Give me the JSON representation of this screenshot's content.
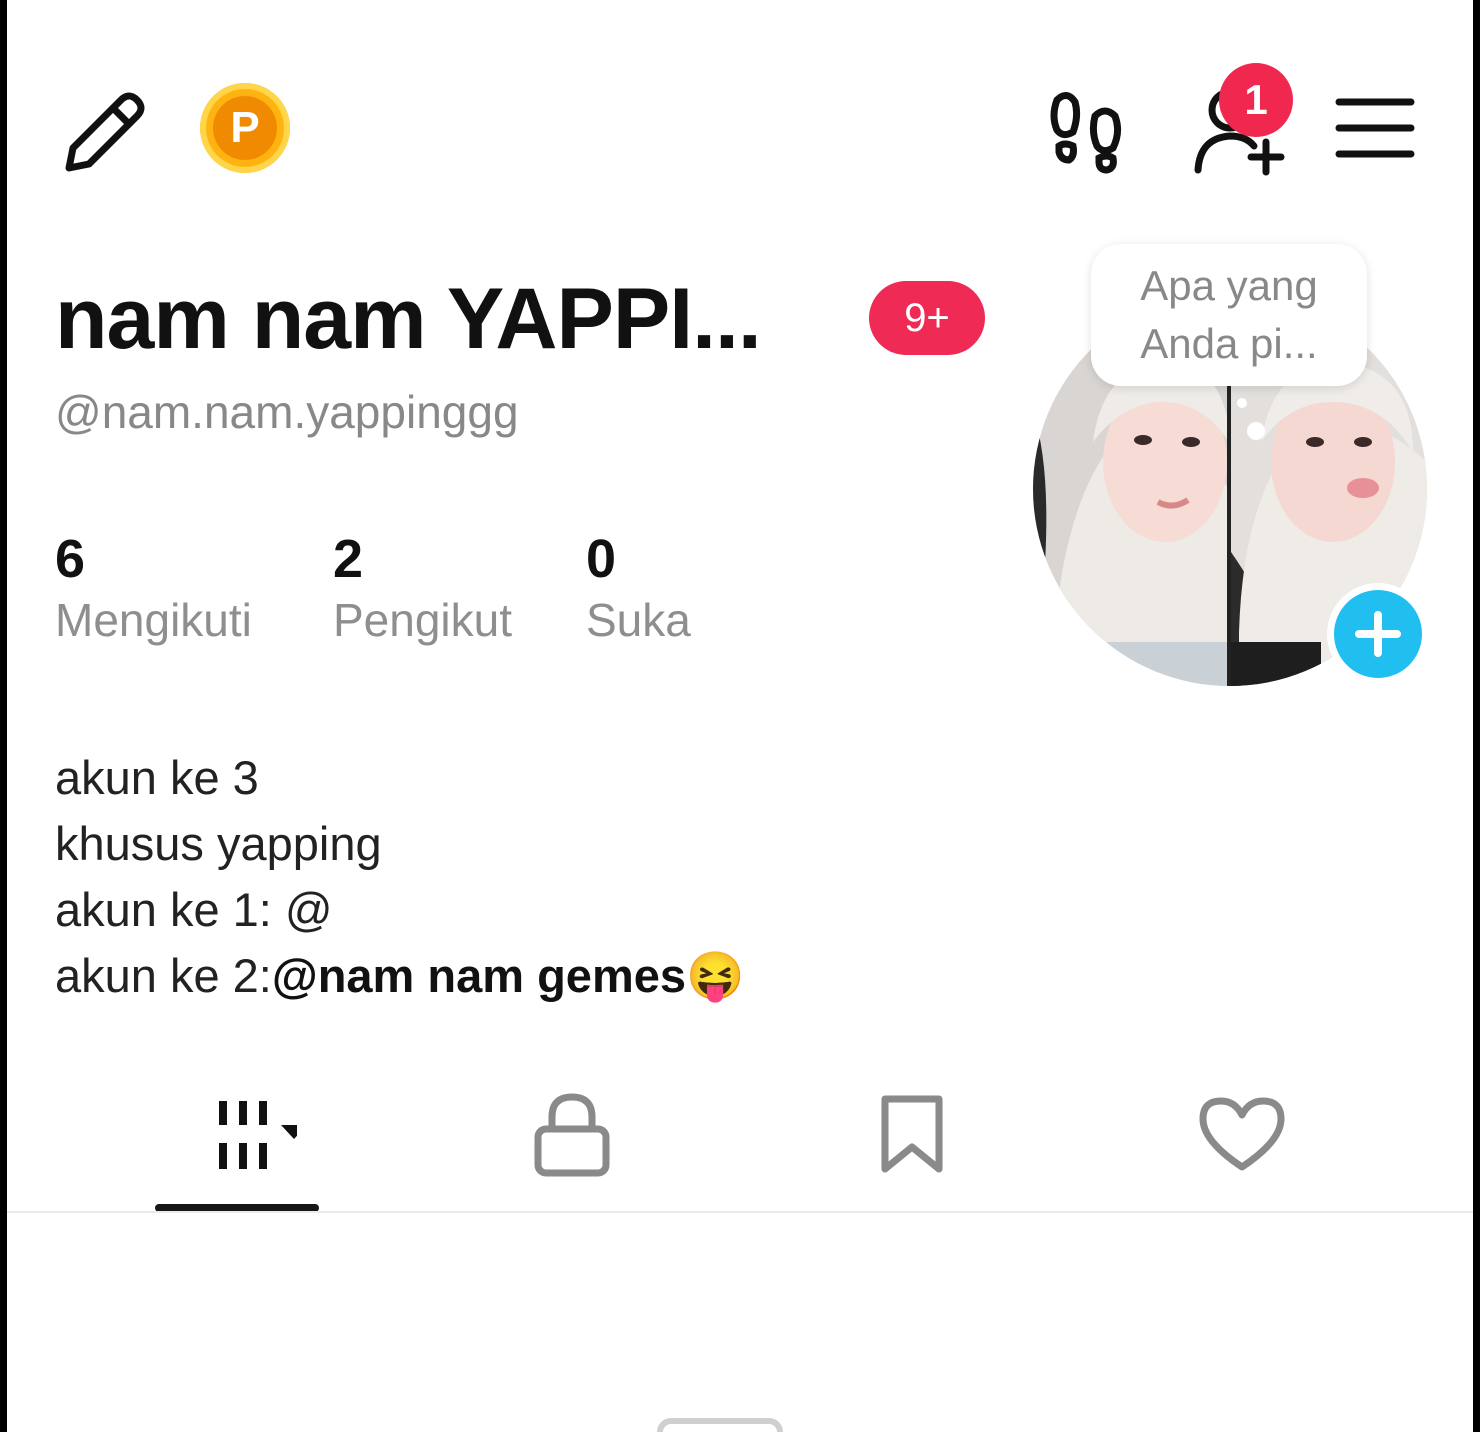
{
  "header": {
    "edit_icon": "pencil-icon",
    "coin_label": "P",
    "footprints_icon": "footprints-icon",
    "add_friend_icon": "add-user-icon",
    "add_friend_badge": "1",
    "menu_icon": "hamburger-menu-icon"
  },
  "profile": {
    "display_name": "nam nam YAPPI...",
    "notification_badge": "9+",
    "username": "@nam.nam.yappinggg",
    "stats": [
      {
        "value": "6",
        "label": "Mengikuti"
      },
      {
        "value": "2",
        "label": "Pengikut"
      },
      {
        "value": "0",
        "label": "Suka"
      }
    ],
    "bio": {
      "line1": "akun ke 3",
      "line2": "khusus yapping",
      "line3": "akun ke 1: @",
      "line4_prefix": "akun ke 2:",
      "line4_mention": "@nam nam gemes",
      "line4_emoji": "😝"
    },
    "thought_bubble": {
      "line1": "Apa yang",
      "line2": "Anda pi..."
    },
    "accent_color": "#20bff0",
    "badge_color": "#ee2a55"
  },
  "tabs": [
    {
      "name": "videos-tab",
      "icon": "grid-dropdown-icon",
      "active": true
    },
    {
      "name": "private-tab",
      "icon": "lock-icon",
      "active": false
    },
    {
      "name": "saved-tab",
      "icon": "bookmark-icon",
      "active": false
    },
    {
      "name": "liked-tab",
      "icon": "heart-icon",
      "active": false
    }
  ]
}
